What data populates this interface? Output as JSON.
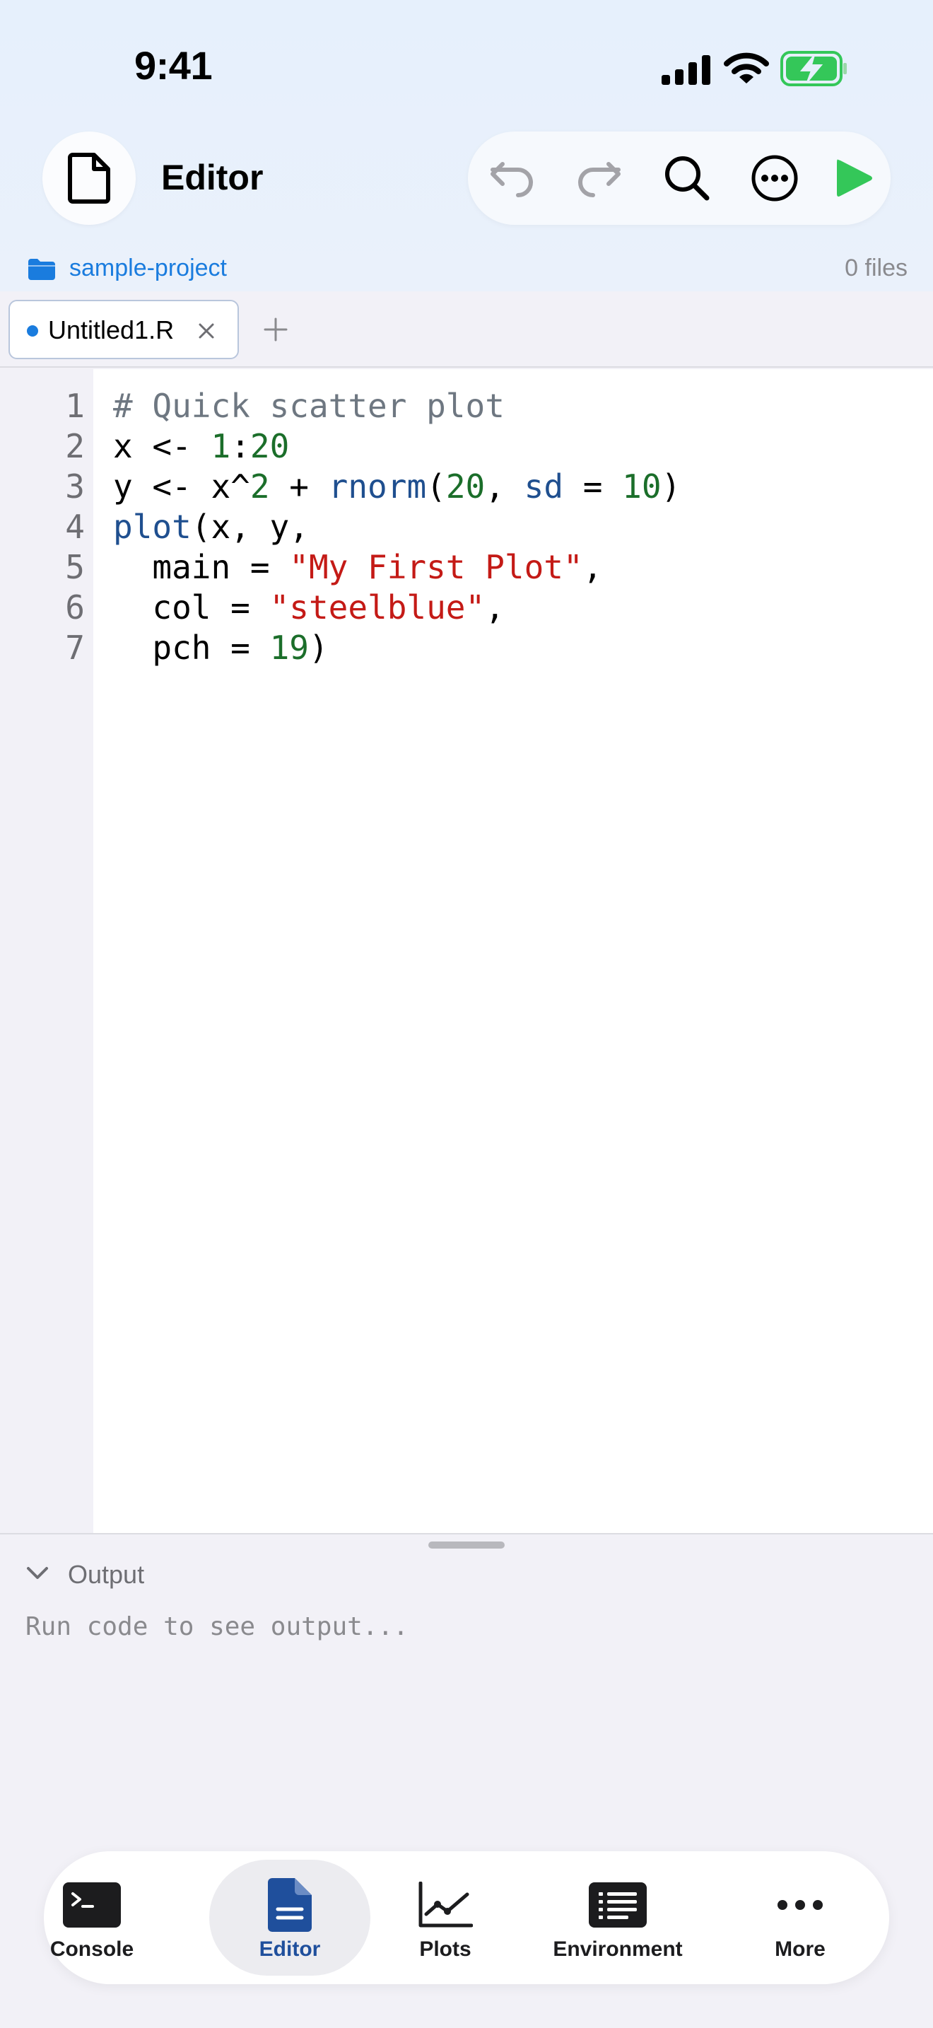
{
  "status_bar": {
    "time": "9:41"
  },
  "header": {
    "title": "Editor"
  },
  "toolbar": {
    "undo_icon": "undo-icon",
    "redo_icon": "redo-icon",
    "search_icon": "search-icon",
    "more_icon": "ellipsis-circle-icon",
    "run_icon": "play-icon"
  },
  "project": {
    "name": "sample-project",
    "file_count": "0 files"
  },
  "tabs": [
    {
      "label": "Untitled1.R",
      "modified": true
    }
  ],
  "editor": {
    "line_numbers": [
      "1",
      "2",
      "3",
      "4",
      "5",
      "6",
      "7"
    ],
    "lines": [
      [
        {
          "t": "# Quick scatter plot",
          "c": "comment"
        }
      ],
      [
        {
          "t": "x <- ",
          "c": ""
        },
        {
          "t": "1",
          "c": "num"
        },
        {
          "t": ":",
          "c": ""
        },
        {
          "t": "20",
          "c": "num"
        }
      ],
      [
        {
          "t": "y <- x^",
          "c": ""
        },
        {
          "t": "2",
          "c": "num"
        },
        {
          "t": " + ",
          "c": ""
        },
        {
          "t": "rnorm",
          "c": "fn"
        },
        {
          "t": "(",
          "c": ""
        },
        {
          "t": "20",
          "c": "num"
        },
        {
          "t": ", ",
          "c": ""
        },
        {
          "t": "sd",
          "c": "arg"
        },
        {
          "t": " = ",
          "c": ""
        },
        {
          "t": "10",
          "c": "num"
        },
        {
          "t": ")",
          "c": ""
        }
      ],
      [
        {
          "t": "plot",
          "c": "fn"
        },
        {
          "t": "(x, y,",
          "c": ""
        }
      ],
      [
        {
          "t": "  main = ",
          "c": ""
        },
        {
          "t": "\"My First Plot\"",
          "c": "str"
        },
        {
          "t": ",",
          "c": ""
        }
      ],
      [
        {
          "t": "  col = ",
          "c": ""
        },
        {
          "t": "\"steelblue\"",
          "c": "str"
        },
        {
          "t": ",",
          "c": ""
        }
      ],
      [
        {
          "t": "  pch = ",
          "c": ""
        },
        {
          "t": "19",
          "c": "num"
        },
        {
          "t": ")",
          "c": ""
        }
      ]
    ]
  },
  "output": {
    "title": "Output",
    "placeholder": "Run code to see output..."
  },
  "nav": {
    "items": [
      {
        "label": "Console",
        "icon": "terminal-icon"
      },
      {
        "label": "Editor",
        "icon": "document-icon",
        "active": true
      },
      {
        "label": "Plots",
        "icon": "chart-line-icon"
      },
      {
        "label": "Environment",
        "icon": "list-icon"
      },
      {
        "label": "More",
        "icon": "ellipsis-icon"
      }
    ]
  },
  "colors": {
    "accent": "#1a7cde",
    "run_green": "#34c759",
    "active_nav": "#1f4f9c"
  }
}
